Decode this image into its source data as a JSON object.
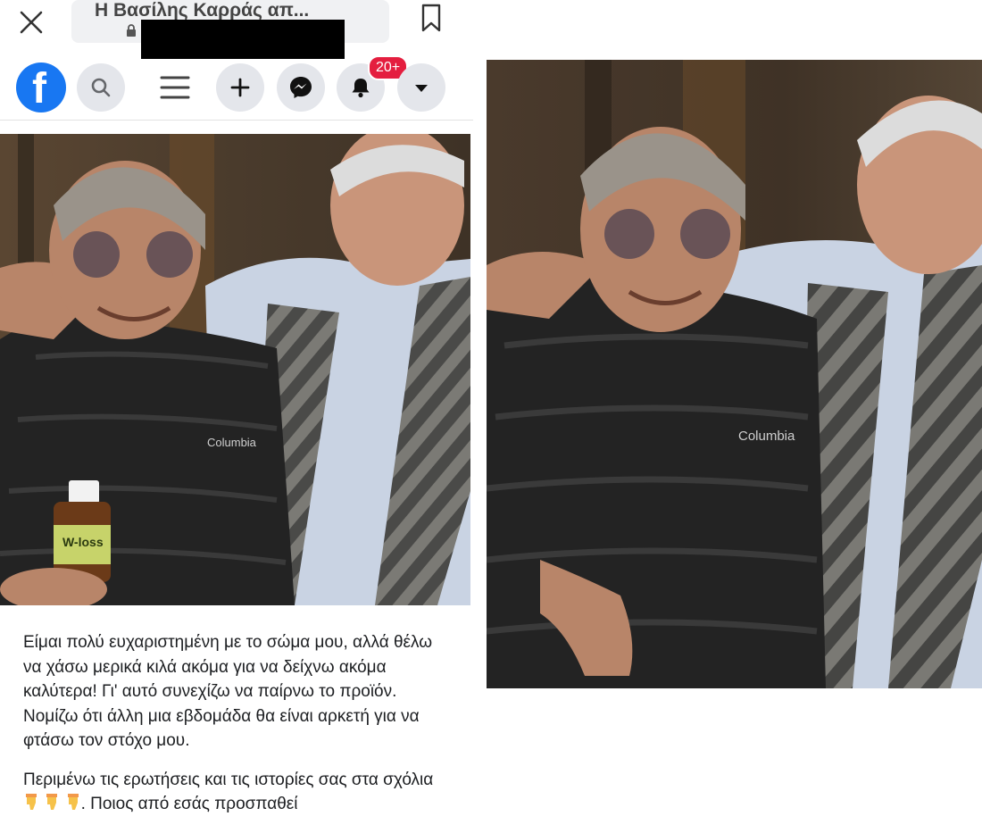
{
  "browser": {
    "page_title": "Η Βασίλης Καρράς απ...",
    "close_icon": "close-icon",
    "lock_icon": "lock-icon",
    "bookmark_icon": "bookmark-icon"
  },
  "navbar": {
    "logo": "facebook-logo",
    "logo_letter": "f",
    "notifications_badge": "20+",
    "accent": "#1877f2",
    "badge_color": "#e41e3f"
  },
  "post": {
    "photo_product_label": "W-loss",
    "jacket_brand": "Columbia",
    "caption_p1": "Είμαι πολύ ευχαριστημένη με το σώμα μου, αλλά θέλω να χάσω μερικά κιλά ακόμα για να δείχνω ακόμα καλύτερα! Γι' αυτό συνεχίζω να παίρνω το προϊόν. Νομίζω ότι άλλη μια εβδομάδα θα είναι αρκετή για να φτάσω τον στόχο μου.",
    "caption_p2_a": "Περιμένω τις ερωτήσεις και τις ιστορίες σας στα σχόλια",
    "caption_p2_b": ". Ποιος από εσάς προσπαθεί"
  },
  "original_photo": {
    "jacket_brand": "Columbia"
  }
}
